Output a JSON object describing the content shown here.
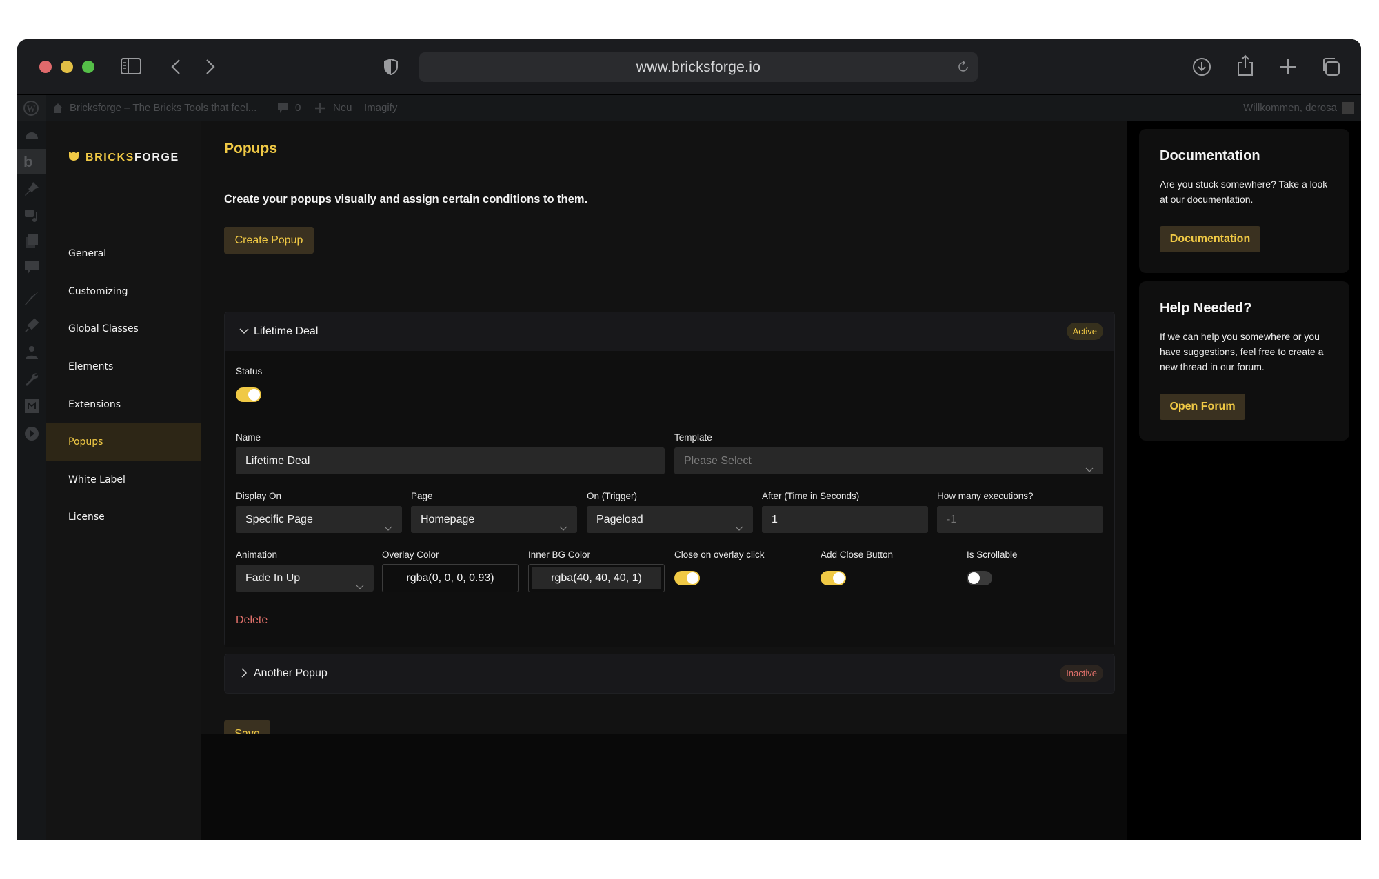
{
  "browser": {
    "url": "www.bricksforge.io",
    "toolbar_icons": [
      "sidebar-icon",
      "back-icon",
      "forward-icon",
      "shield-icon",
      "reload-icon",
      "download-icon",
      "share-icon",
      "new-tab-icon",
      "tabs-overview-icon"
    ]
  },
  "adminbar": {
    "site_name": "Bricksforge – The Bricks Tools that feel...",
    "comments_count": "0",
    "new_label": "Neu",
    "imagify_label": "Imagify",
    "greeting": "Willkommen, derosa"
  },
  "sidebar": {
    "brand_part1": "BRICKS",
    "brand_part2": "FORGE",
    "items": [
      {
        "label": "General"
      },
      {
        "label": "Customizing"
      },
      {
        "label": "Global Classes"
      },
      {
        "label": "Elements"
      },
      {
        "label": "Extensions"
      },
      {
        "label": "Popups",
        "active": true
      },
      {
        "label": "White Label"
      },
      {
        "label": "License"
      }
    ]
  },
  "main": {
    "title": "Popups",
    "description": "Create your popups visually and assign certain conditions to them.",
    "create_button": "Create Popup",
    "save_button": "Save",
    "popups": [
      {
        "title": "Lifetime Deal",
        "status_badge": "Active",
        "expanded": true,
        "fields": {
          "status_label": "Status",
          "status_on": true,
          "name_label": "Name",
          "name_value": "Lifetime Deal",
          "template_label": "Template",
          "template_placeholder": "Please Select",
          "display_on_label": "Display On",
          "display_on_value": "Specific Page",
          "page_label": "Page",
          "page_value": "Homepage",
          "trigger_label": "On (Trigger)",
          "trigger_value": "Pageload",
          "after_label": "After (Time in Seconds)",
          "after_value": "1",
          "executions_label": "How many executions?",
          "executions_placeholder": "-1",
          "animation_label": "Animation",
          "animation_value": "Fade In Up",
          "overlay_color_label": "Overlay Color",
          "overlay_color_value": "rgba(0, 0, 0, 0.93)",
          "inner_bg_label": "Inner BG Color",
          "inner_bg_value": "rgba(40, 40, 40, 1)",
          "close_overlay_label": "Close on overlay click",
          "close_overlay_on": true,
          "add_close_label": "Add Close Button",
          "add_close_on": true,
          "scrollable_label": "Is Scrollable",
          "scrollable_on": false,
          "delete_label": "Delete"
        }
      },
      {
        "title": "Another Popup",
        "status_badge": "Inactive",
        "expanded": false
      }
    ]
  },
  "cards": {
    "documentation": {
      "title": "Documentation",
      "text": "Are you stuck somewhere? Take a look at our documentation.",
      "button": "Documentation"
    },
    "help": {
      "title": "Help Needed?",
      "text": "If we can help you somewhere or you have suggestions, feel free to create a new thread in our forum.",
      "button": "Open Forum"
    }
  },
  "colors": {
    "accent": "#f0c945",
    "accent_bg": "#3a3120",
    "danger": "#e0706a",
    "background": "#121212"
  }
}
